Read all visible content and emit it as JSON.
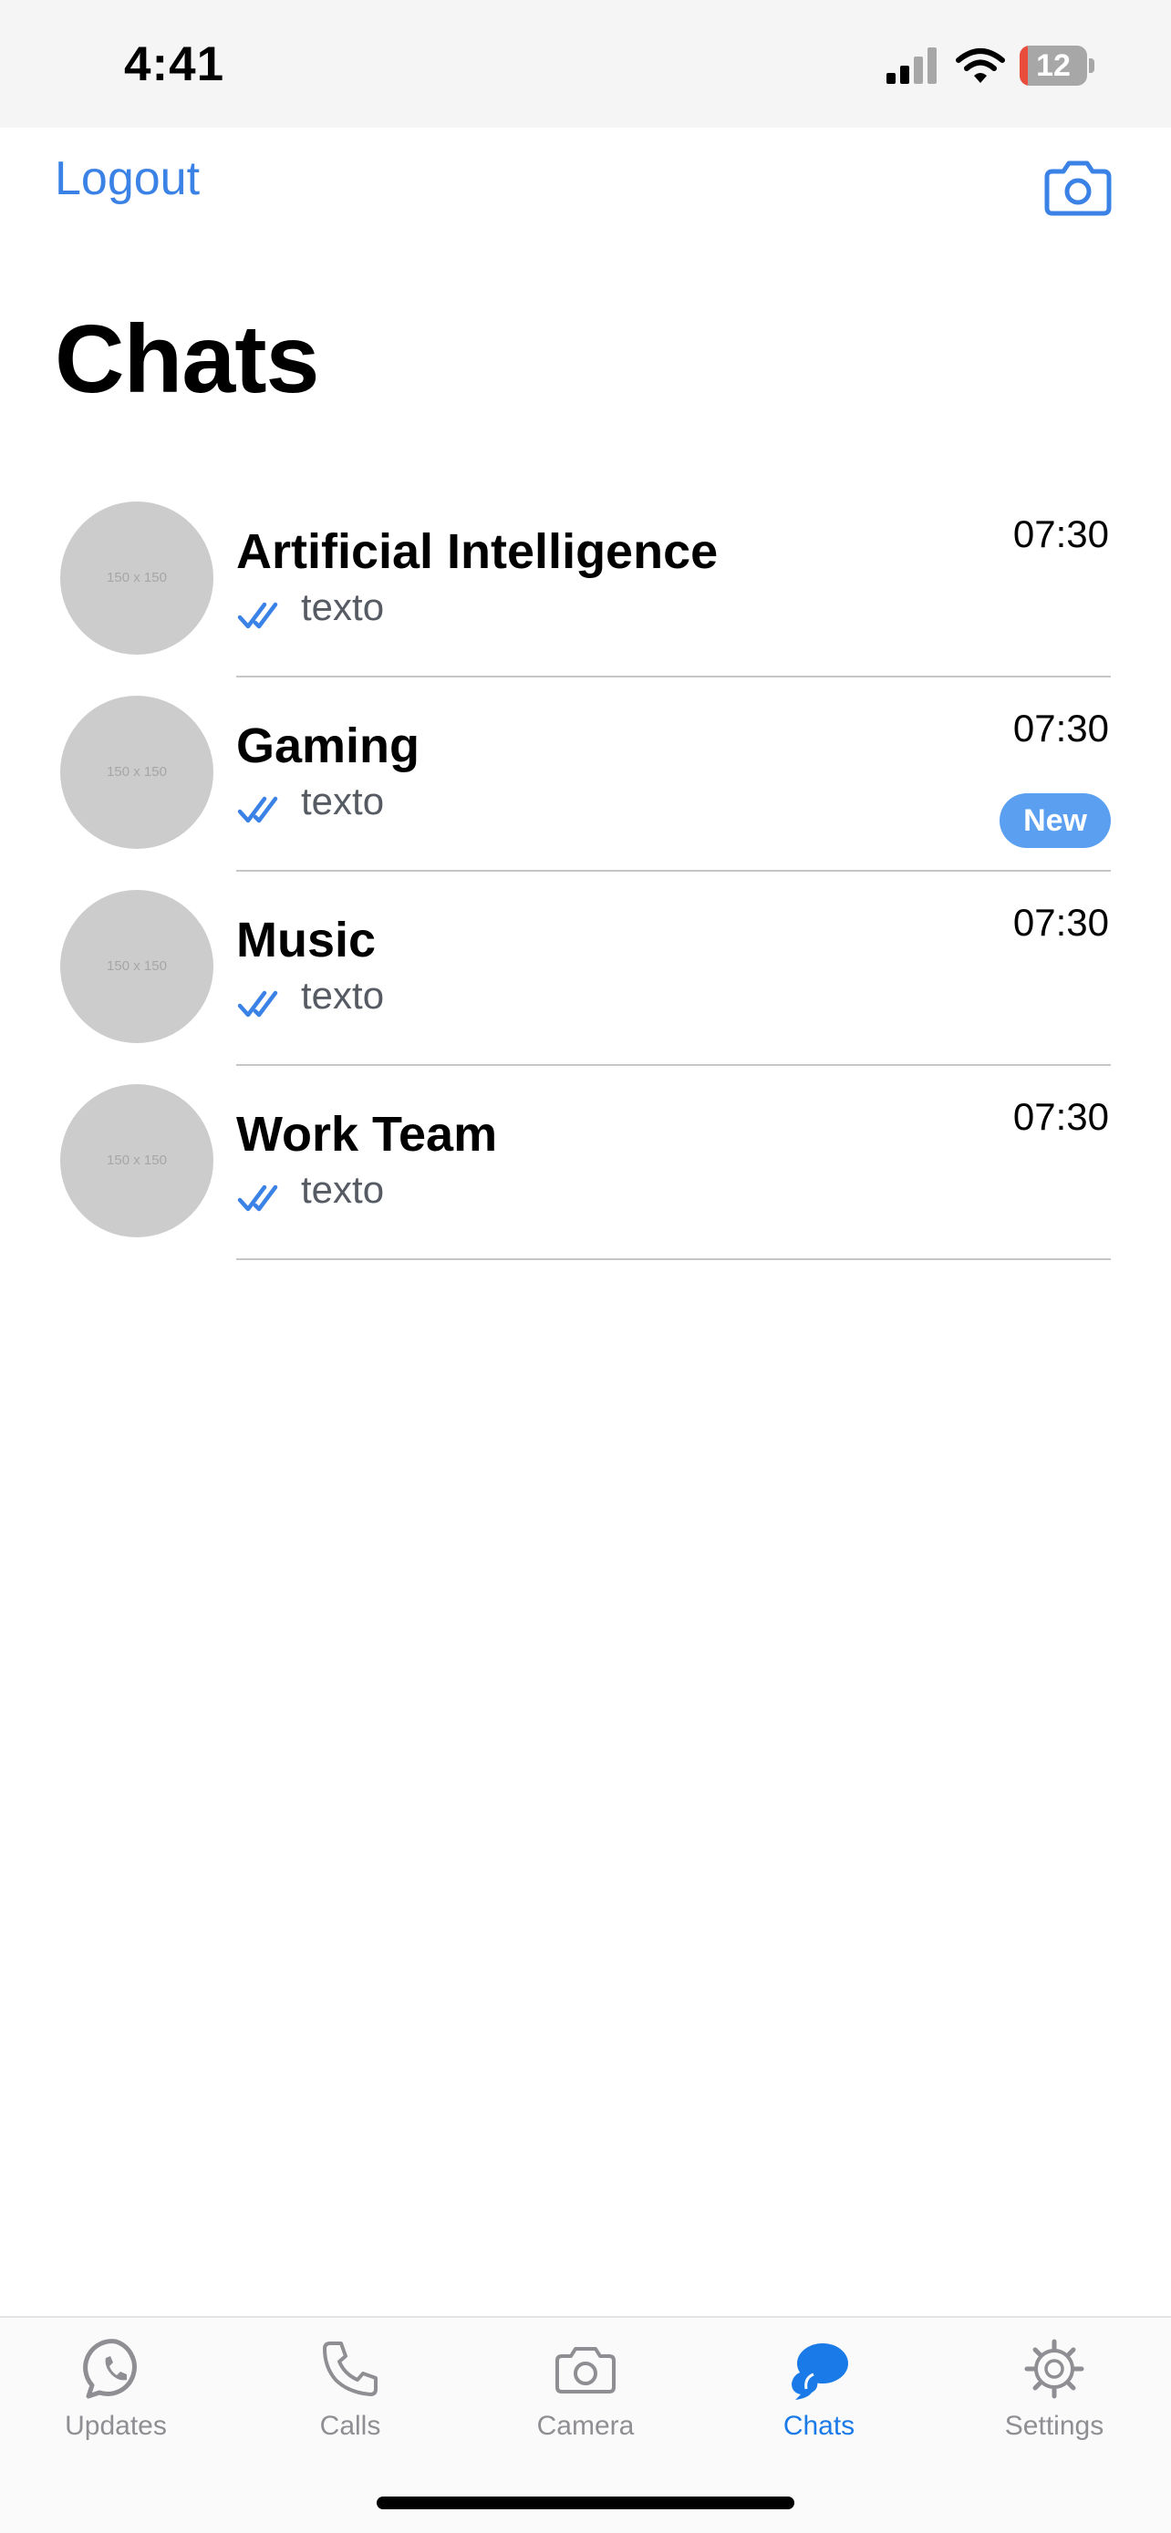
{
  "status_bar": {
    "time": "4:41",
    "battery_percent": "12",
    "battery_level": 0.12
  },
  "header": {
    "logout_label": "Logout",
    "camera_icon": "camera-icon",
    "title": "Chats"
  },
  "chats": [
    {
      "avatar_text": "150 x 150",
      "name": "Artificial Intelligence",
      "preview": "texto",
      "time": "07:30",
      "badge": ""
    },
    {
      "avatar_text": "150 x 150",
      "name": "Gaming",
      "preview": "texto",
      "time": "07:30",
      "badge": "New"
    },
    {
      "avatar_text": "150 x 150",
      "name": "Music",
      "preview": "texto",
      "time": "07:30",
      "badge": ""
    },
    {
      "avatar_text": "150 x 150",
      "name": "Work Team",
      "preview": "texto",
      "time": "07:30",
      "badge": ""
    }
  ],
  "tab_bar": {
    "tabs": [
      {
        "label": "Updates",
        "icon": "whatsapp-icon",
        "active": false
      },
      {
        "label": "Calls",
        "icon": "phone-icon",
        "active": false
      },
      {
        "label": "Camera",
        "icon": "camera-icon",
        "active": false
      },
      {
        "label": "Chats",
        "icon": "chat-bubbles-icon",
        "active": true
      },
      {
        "label": "Settings",
        "icon": "gear-icon",
        "active": false
      }
    ]
  },
  "colors": {
    "accent": "#3b82e6",
    "tab_active": "#1a7ae8",
    "tab_inactive": "#8e8e93",
    "badge": "#5b9ff0",
    "avatar": "#cccccc",
    "battery_low": "#eb4d3d"
  }
}
